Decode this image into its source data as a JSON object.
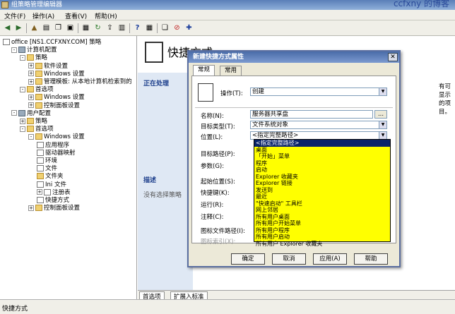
{
  "window": {
    "title": "组策略管理编辑器",
    "watermark": "ccfxny 的博客"
  },
  "menu": [
    "文件(F)",
    "操作(A)",
    "查看(V)",
    "帮助(H)"
  ],
  "tree": [
    {
      "label": "office [NS1.CCFXNY.COM] 策略",
      "indent": 0,
      "pm": "",
      "icon": "doc"
    },
    {
      "label": "计算机配置",
      "indent": 1,
      "pm": "-",
      "icon": "gear"
    },
    {
      "label": "策略",
      "indent": 2,
      "pm": "-",
      "icon": "folder"
    },
    {
      "label": "软件设置",
      "indent": 3,
      "pm": "+",
      "icon": "folder"
    },
    {
      "label": "Windows 设置",
      "indent": 3,
      "pm": "+",
      "icon": "folder"
    },
    {
      "label": "管理模板: 从本地计算机检索到的",
      "indent": 3,
      "pm": "+",
      "icon": "folder"
    },
    {
      "label": "首选项",
      "indent": 2,
      "pm": "-",
      "icon": "folder"
    },
    {
      "label": "Windows 设置",
      "indent": 3,
      "pm": "+",
      "icon": "folder"
    },
    {
      "label": "控制面板设置",
      "indent": 3,
      "pm": "+",
      "icon": "folder"
    },
    {
      "label": "用户配置",
      "indent": 1,
      "pm": "-",
      "icon": "gear"
    },
    {
      "label": "策略",
      "indent": 2,
      "pm": "+",
      "icon": "folder"
    },
    {
      "label": "首选项",
      "indent": 2,
      "pm": "-",
      "icon": "folder"
    },
    {
      "label": "Windows 设置",
      "indent": 3,
      "pm": "-",
      "icon": "folder"
    },
    {
      "label": "应用程序",
      "indent": 4,
      "pm": "",
      "icon": "doc"
    },
    {
      "label": "驱动器映射",
      "indent": 4,
      "pm": "",
      "icon": "doc"
    },
    {
      "label": "环境",
      "indent": 4,
      "pm": "",
      "icon": "doc"
    },
    {
      "label": "文件",
      "indent": 4,
      "pm": "",
      "icon": "doc"
    },
    {
      "label": "文件夹",
      "indent": 4,
      "pm": "",
      "icon": "folder"
    },
    {
      "label": "Ini 文件",
      "indent": 4,
      "pm": "",
      "icon": "doc"
    },
    {
      "label": "注册表",
      "indent": 4,
      "pm": "+",
      "icon": "doc"
    },
    {
      "label": "快捷方式",
      "indent": 4,
      "pm": "",
      "icon": "doc"
    },
    {
      "label": "控制面板设置",
      "indent": 3,
      "pm": "+",
      "icon": "folder"
    }
  ],
  "right": {
    "heading": "快捷方式",
    "side_heading1": "正在处理",
    "side_heading2": "描述",
    "side_note": "没有选择策略",
    "right_note": "有可显示的项目。"
  },
  "status_tabs": [
    "首选项",
    "扩展入标准"
  ],
  "statusbar": "快捷方式",
  "dialog": {
    "title": "新建快捷方式属性",
    "tabs": [
      "常规",
      "常用"
    ],
    "action_label": "操作(T):",
    "action_value": "创建",
    "name_label": "名称(N):",
    "name_value": "服务器共享盘",
    "browse": "...",
    "target_type_label": "目标类型(T):",
    "target_type_value": "文件系统对象",
    "location_label": "位置(L):",
    "location_value": "<指定完整路径>",
    "target_path_label": "目标路径(P):",
    "args_label": "参数(G):",
    "start_label": "起始位置(S):",
    "hotkey_label": "快捷键(K):",
    "run_label": "运行(R):",
    "comment_label": "注释(C):",
    "iconpath_label": "图标文件路径(I):",
    "iconindex_label": "图标索引(X):",
    "buttons": [
      "确定",
      "取消",
      "应用(A)",
      "帮助"
    ],
    "dropdown": [
      "<指定完整路径>",
      "桌面",
      "「开始」菜单",
      "程序",
      "启动",
      "Explorer 收藏夹",
      "Explorer 链接",
      "发送到",
      "最近",
      "\"快速启动\" 工具栏",
      "网上邻居",
      "所有用户桌面",
      "所有用户开始菜单",
      "所有用户程序",
      "所有用户启动",
      "所有用户 Explorer 收藏夹"
    ]
  }
}
